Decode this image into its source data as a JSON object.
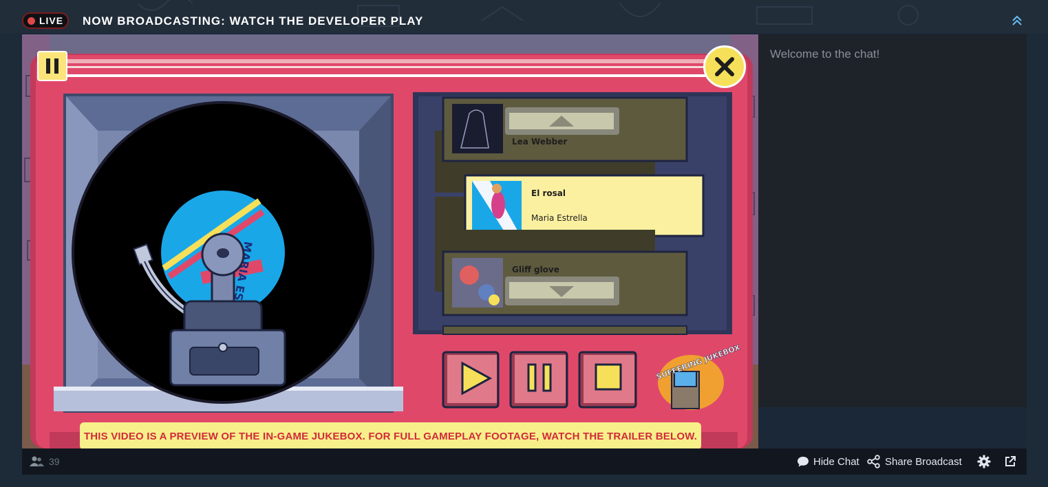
{
  "header": {
    "live_label": "LIVE",
    "title": "NOW BROADCASTING: WATCH THE DEVELOPER PLAY"
  },
  "video": {
    "jukebox": {
      "tracks": [
        {
          "title": "",
          "artist": "Lea Webber",
          "album_art_text": "Lea Webber"
        },
        {
          "title": "El rosal",
          "artist": "Maria Estrella",
          "selected": true
        },
        {
          "title": "Gliff glove",
          "artist": ""
        }
      ],
      "record_label_text": "MARIA ESTRELLA",
      "logo_text": "SUFFERING JUKEBOX",
      "controls": [
        "play-icon",
        "pause-icon",
        "stop-icon"
      ]
    },
    "disclaimer": "THIS VIDEO IS A PREVIEW OF THE IN-GAME JUKEBOX. FOR FULL GAMEPLAY FOOTAGE, WATCH THE TRAILER BELOW."
  },
  "chat": {
    "welcome": "Welcome to the chat!"
  },
  "footer": {
    "viewers": "39",
    "hide_chat": "Hide Chat",
    "share_broadcast": "Share Broadcast",
    "icons": [
      "users-icon",
      "chat-bubble-icon",
      "share-icon",
      "gear-icon",
      "popout-icon"
    ]
  },
  "colors": {
    "page_bg": "#1b2838",
    "jukebox_red": "#e0486a",
    "panel_olive": "#5e5a3e",
    "highlight_yellow": "#fbf0a0",
    "disclaimer_text": "#d12a3a",
    "live_dot": "#e04848"
  }
}
